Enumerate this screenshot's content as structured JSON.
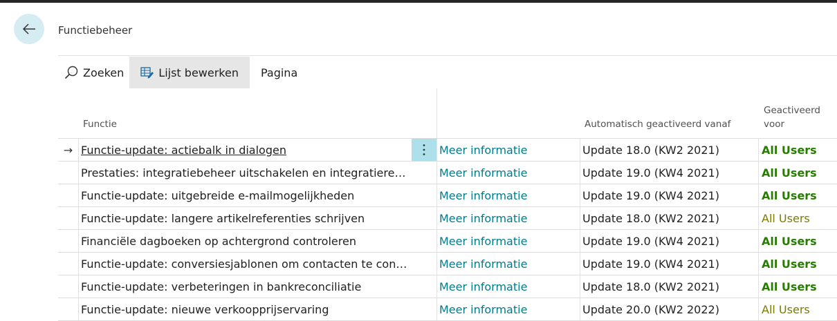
{
  "page": {
    "title": "Functiebeheer"
  },
  "toolbar": {
    "search_label": "Zoeken",
    "edit_list_label": "Lijst bewerken",
    "page_label": "Pagina"
  },
  "columns": {
    "function": "Functie",
    "auto_activated": "Automatisch geactiveerd vanaf",
    "activated_for": "Geactiveerd voor"
  },
  "rows": [
    {
      "name": "Functie-update: actiebalk in dialogen",
      "link": "Meer informatie",
      "update": "Update 18.0 (KW2 2021)",
      "activated": "All Users",
      "bold": true
    },
    {
      "name": "Prestaties: integratiebeheer uitschakelen en integratierecord ...",
      "link": "Meer informatie",
      "update": "Update 19.0 (KW4 2021)",
      "activated": "All Users",
      "bold": true
    },
    {
      "name": "Functie-update: uitgebreide e-mailmogelijkheden",
      "link": "Meer informatie",
      "update": "Update 19.0 (KW4 2021)",
      "activated": "All Users",
      "bold": true
    },
    {
      "name": "Functie-update: langere artikelreferenties schrijven",
      "link": "Meer informatie",
      "update": "Update 18.0 (KW2 2021)",
      "activated": "All Users",
      "bold": false
    },
    {
      "name": "Financiële dagboeken op achtergrond controleren",
      "link": "Meer informatie",
      "update": "Update 19.0 (KW4 2021)",
      "activated": "All Users",
      "bold": true
    },
    {
      "name": "Functie-update: conversiesjablonen om contacten te convert...",
      "link": "Meer informatie",
      "update": "Update 19.0 (KW4 2021)",
      "activated": "All Users",
      "bold": true
    },
    {
      "name": "Functie-update: verbeteringen in bankreconciliatie",
      "link": "Meer informatie",
      "update": "Update 18.0 (KW2 2021)",
      "activated": "All Users",
      "bold": true
    },
    {
      "name": "Functie-update: nieuwe verkoopprijservaring",
      "link": "Meer informatie",
      "update": "Update 20.0 (KW2 2022)",
      "activated": "All Users",
      "bold": false
    }
  ]
}
